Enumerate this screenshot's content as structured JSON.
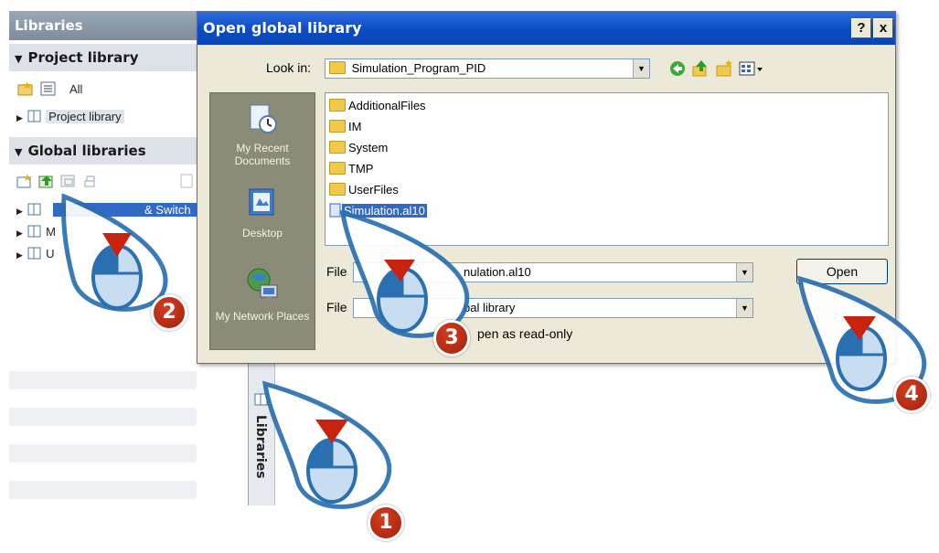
{
  "libraries_panel": {
    "title": "Libraries",
    "project_library_header": "Project library",
    "filter_value": "All",
    "project_tree_item": "Project library",
    "global_libraries_header": "Global libraries",
    "global_tree_items": [
      {
        "label": "Buttons-and-Switches (partially covered)",
        "visible_text": "& Switch"
      },
      {
        "label": "M",
        "visible_text": "M"
      },
      {
        "label": "U",
        "visible_text": "U"
      }
    ]
  },
  "side_tab": {
    "label": "Libraries"
  },
  "dialog": {
    "title": "Open global library",
    "help_button": "?",
    "close_button": "x",
    "look_in_label": "Look in:",
    "look_in_value": "Simulation_Program_PID",
    "places": [
      {
        "icon": "recent-documents-icon",
        "label": "My Recent Documents"
      },
      {
        "icon": "desktop-icon",
        "label": "Desktop"
      },
      {
        "icon": "network-places-icon",
        "label": "My Network Places"
      }
    ],
    "files": [
      {
        "name": "AdditionalFiles",
        "type": "folder"
      },
      {
        "name": "IM",
        "type": "folder"
      },
      {
        "name": "System",
        "type": "folder"
      },
      {
        "name": "TMP",
        "type": "folder"
      },
      {
        "name": "UserFiles",
        "type": "folder"
      },
      {
        "name": "Simulation.al10",
        "type": "library",
        "selected": true
      }
    ],
    "file_name_label": "File",
    "file_name_value": "nulation.al10",
    "file_type_label": "File",
    "file_type_value": "bal library",
    "read_only_label": "pen as read-only",
    "open_button": "Open"
  },
  "callouts": [
    {
      "number": "1"
    },
    {
      "number": "2"
    },
    {
      "number": "3"
    },
    {
      "number": "4"
    }
  ],
  "colors": {
    "titlebar": "#0a4bc4",
    "selection": "#316ac5",
    "callout_badge": "#b8280f",
    "callout_ring": "#2a6fb0"
  }
}
